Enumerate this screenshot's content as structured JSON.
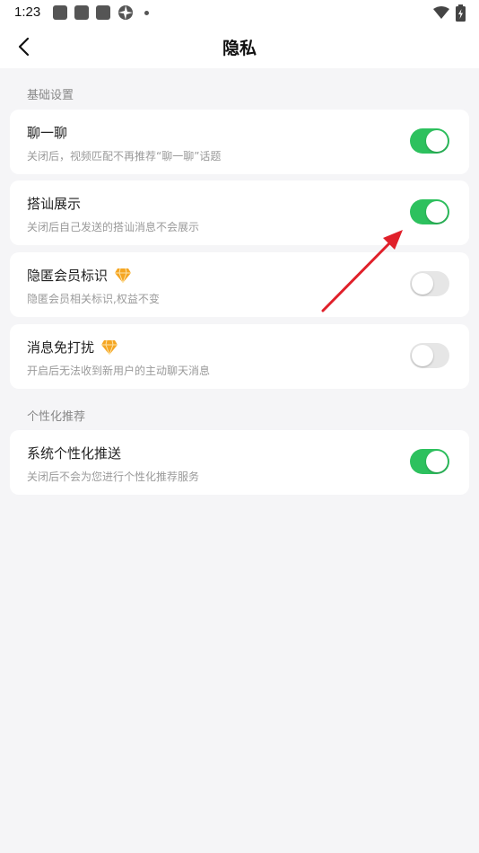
{
  "status_bar": {
    "time": "1:23"
  },
  "header": {
    "title": "隐私",
    "back_icon": "chevron-left-icon"
  },
  "sections": [
    {
      "label": "基础设置",
      "items": [
        {
          "title": "聊一聊",
          "desc": "关闭后，视频匹配不再推荐“聊一聊”话题",
          "enabled": true,
          "vip": false
        },
        {
          "title": "搭讪展示",
          "desc": "关闭后自己发送的搭讪消息不会展示",
          "enabled": true,
          "vip": false
        },
        {
          "title": "隐匿会员标识",
          "desc": "隐匿会员相关标识,权益不变",
          "enabled": false,
          "vip": true
        },
        {
          "title": "消息免打扰",
          "desc": "开启后无法收到新用户的主动聊天消息",
          "enabled": false,
          "vip": true
        }
      ]
    },
    {
      "label": "个性化推荐",
      "items": [
        {
          "title": "系统个性化推送",
          "desc": "关闭后不会为您进行个性化推荐服务",
          "enabled": true,
          "vip": false
        }
      ]
    }
  ],
  "colors": {
    "toggle_on": "#2dc15e",
    "toggle_off": "#e6e6e6",
    "vip_diamond": "#f5a623",
    "annotation_arrow": "#e0202a"
  }
}
